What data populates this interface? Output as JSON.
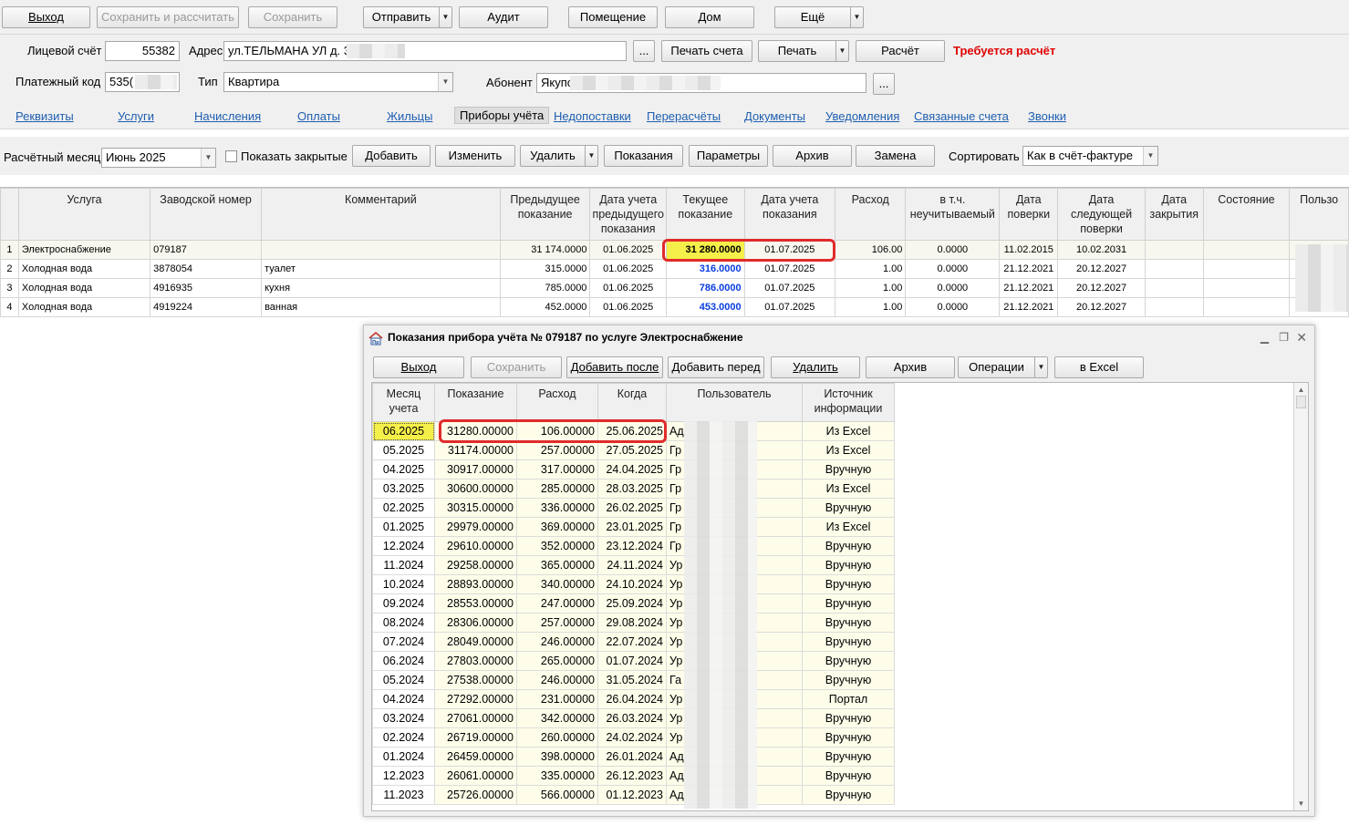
{
  "toolbar": {
    "exit": "Выход",
    "save_calc": "Сохранить и рассчитать",
    "save": "Сохранить",
    "send": "Отправить",
    "audit": "Аудит",
    "room": "Помещение",
    "house": "Дом",
    "more": "Ещё"
  },
  "account": {
    "account_label": "Лицевой счёт",
    "account_value": "55382",
    "address_label": "Адрес",
    "address_value": "ул.ТЕЛЬМАНА УЛ д. 32",
    "ellipsis": "...",
    "print_account": "Печать счета",
    "print": "Печать",
    "calc": "Расчёт",
    "calc_required": "Требуется расчёт",
    "pay_code_label": "Платежный код",
    "pay_code_value": "535(",
    "type_label": "Тип",
    "type_value": "Квартира",
    "subscriber_label": "Абонент",
    "subscriber_value": "Якупо"
  },
  "tabs": [
    "Реквизиты",
    "Услуги",
    "Начисления",
    "Оплаты",
    "Жильцы",
    "Приборы учёта",
    "Недопоставки",
    "Перерасчёты",
    "Документы",
    "Уведомления",
    "Связанные счета",
    "Звонки"
  ],
  "meters_toolbar": {
    "month_label": "Расчётный месяц",
    "month_value": "Июнь 2025",
    "show_closed": "Показать закрытые",
    "add": "Добавить",
    "edit": "Изменить",
    "delete": "Удалить",
    "readings": "Показания",
    "params": "Параметры",
    "archive": "Архив",
    "replace": "Замена",
    "sort_label": "Сортировать",
    "sort_value": "Как в счёт-фактуре"
  },
  "meters_grid": {
    "headers": [
      "Услуга",
      "Заводской номер",
      "Комментарий",
      "Предыдущее показание",
      "Дата учета предыдущего показания",
      "Текущее показание",
      "Дата учета показания",
      "Расход",
      "в т.ч. неучитываемый",
      "Дата поверки",
      "Дата следующей поверки",
      "Дата закрытия",
      "Состояние",
      "Пользо"
    ],
    "rows": [
      {
        "n": "1",
        "service": "Электроснабжение",
        "serial": "079187",
        "comment": "",
        "prev": "31 174.0000",
        "prev_date": "01.06.2025",
        "cur": "31 280.0000",
        "cur_date": "01.07.2025",
        "usage": "106.00",
        "unacc": "0.0000",
        "check": "11.02.2015",
        "next_check": "10.02.2031",
        "closed": "",
        "state": ""
      },
      {
        "n": "2",
        "service": "Холодная вода",
        "serial": "3878054",
        "comment": "туалет",
        "prev": "315.0000",
        "prev_date": "01.06.2025",
        "cur": "316.0000",
        "cur_date": "01.07.2025",
        "usage": "1.00",
        "unacc": "0.0000",
        "check": "21.12.2021",
        "next_check": "20.12.2027",
        "closed": "",
        "state": ""
      },
      {
        "n": "3",
        "service": "Холодная вода",
        "serial": "4916935",
        "comment": "кухня",
        "prev": "785.0000",
        "prev_date": "01.06.2025",
        "cur": "786.0000",
        "cur_date": "01.07.2025",
        "usage": "1.00",
        "unacc": "0.0000",
        "check": "21.12.2021",
        "next_check": "20.12.2027",
        "closed": "",
        "state": ""
      },
      {
        "n": "4",
        "service": "Холодная вода",
        "serial": "4919224",
        "comment": "ванная",
        "prev": "452.0000",
        "prev_date": "01.06.2025",
        "cur": "453.0000",
        "cur_date": "01.07.2025",
        "usage": "1.00",
        "unacc": "0.0000",
        "check": "21.12.2021",
        "next_check": "20.12.2027",
        "closed": "",
        "state": ""
      }
    ]
  },
  "dialog": {
    "title": "Показания прибора учёта № 079187 по услуге Электроснабжение",
    "buttons": {
      "exit": "Выход",
      "save": "Сохранить",
      "add_after": "Добавить после",
      "add_before": "Добавить перед",
      "delete": "Удалить",
      "archive": "Архив",
      "operations": "Операции",
      "excel": "в Excel"
    },
    "headers": [
      "Месяц учета",
      "Показание",
      "Расход",
      "Когда",
      "Пользователь",
      "Источник информации"
    ],
    "rows": [
      {
        "month": "06.2025",
        "value": "31280.00000",
        "usage": "106.00000",
        "when": "25.06.2025",
        "user": "Ад",
        "source": "Из Excel"
      },
      {
        "month": "05.2025",
        "value": "31174.00000",
        "usage": "257.00000",
        "when": "27.05.2025",
        "user": "Гр",
        "source": "Из Excel"
      },
      {
        "month": "04.2025",
        "value": "30917.00000",
        "usage": "317.00000",
        "when": "24.04.2025",
        "user": "Гр",
        "source": "Вручную"
      },
      {
        "month": "03.2025",
        "value": "30600.00000",
        "usage": "285.00000",
        "when": "28.03.2025",
        "user": "Гр",
        "source": "Из Excel"
      },
      {
        "month": "02.2025",
        "value": "30315.00000",
        "usage": "336.00000",
        "when": "26.02.2025",
        "user": "Гр",
        "source": "Вручную"
      },
      {
        "month": "01.2025",
        "value": "29979.00000",
        "usage": "369.00000",
        "when": "23.01.2025",
        "user": "Гр",
        "source": "Из Excel"
      },
      {
        "month": "12.2024",
        "value": "29610.00000",
        "usage": "352.00000",
        "when": "23.12.2024",
        "user": "Гр",
        "source": "Вручную"
      },
      {
        "month": "11.2024",
        "value": "29258.00000",
        "usage": "365.00000",
        "when": "24.11.2024",
        "user": "Ур",
        "source": "Вручную"
      },
      {
        "month": "10.2024",
        "value": "28893.00000",
        "usage": "340.00000",
        "when": "24.10.2024",
        "user": "Ур",
        "source": "Вручную"
      },
      {
        "month": "09.2024",
        "value": "28553.00000",
        "usage": "247.00000",
        "when": "25.09.2024",
        "user": "Ур",
        "source": "Вручную"
      },
      {
        "month": "08.2024",
        "value": "28306.00000",
        "usage": "257.00000",
        "when": "29.08.2024",
        "user": "Ур",
        "source": "Вручную"
      },
      {
        "month": "07.2024",
        "value": "28049.00000",
        "usage": "246.00000",
        "when": "22.07.2024",
        "user": "Ур",
        "source": "Вручную"
      },
      {
        "month": "06.2024",
        "value": "27803.00000",
        "usage": "265.00000",
        "when": "01.07.2024",
        "user": "Ур",
        "source": "Вручную"
      },
      {
        "month": "05.2024",
        "value": "27538.00000",
        "usage": "246.00000",
        "when": "31.05.2024",
        "user": "Га",
        "source": "Вручную"
      },
      {
        "month": "04.2024",
        "value": "27292.00000",
        "usage": "231.00000",
        "when": "26.04.2024",
        "user": "Ур",
        "source": "Портал"
      },
      {
        "month": "03.2024",
        "value": "27061.00000",
        "usage": "342.00000",
        "when": "26.03.2024",
        "user": "Ур",
        "source": "Вручную"
      },
      {
        "month": "02.2024",
        "value": "26719.00000",
        "usage": "260.00000",
        "when": "24.02.2024",
        "user": "Ур",
        "source": "Вручную"
      },
      {
        "month": "01.2024",
        "value": "26459.00000",
        "usage": "398.00000",
        "when": "26.01.2024",
        "user": "Ад",
        "source": "Вручную"
      },
      {
        "month": "12.2023",
        "value": "26061.00000",
        "usage": "335.00000",
        "when": "26.12.2023",
        "user": "Ад",
        "source": "Вручную"
      },
      {
        "month": "11.2023",
        "value": "25726.00000",
        "usage": "566.00000",
        "when": "01.12.2023",
        "user": "Ад",
        "source": "Вручную"
      }
    ]
  },
  "icons": {
    "app": "house-icon",
    "minimize": "minimize-icon",
    "restore": "restore-icon",
    "close": "close-icon"
  },
  "colors": {
    "highlight": "#f5ef4a",
    "accent_blue": "#0a3de0",
    "alert_red": "#e00000",
    "link": "#1f5fb0"
  }
}
